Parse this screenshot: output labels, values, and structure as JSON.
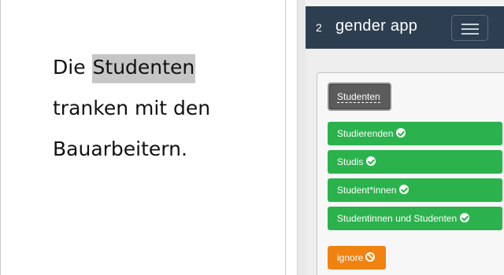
{
  "document": {
    "text_before": "Die ",
    "highlighted_word": "Studenten",
    "text_after_line1": "",
    "line2": "tranken mit den",
    "line3": "Bauarbeitern."
  },
  "navbar": {
    "version": "2",
    "brand": "gender app",
    "menu_icon": "hamburger-icon"
  },
  "panel": {
    "selected_word": "Studenten",
    "alternatives": [
      {
        "label": "Studierenden",
        "icon": "check-circle-icon"
      },
      {
        "label": "Studis",
        "icon": "check-circle-icon"
      },
      {
        "label": "Student*innen",
        "icon": "check-circle-icon"
      },
      {
        "label": "Studentinnen und Studenten",
        "icon": "check-circle-icon"
      }
    ],
    "ignore_label": "ignore",
    "ignore_icon": "ban-icon"
  },
  "colors": {
    "navbar": "#2d3e50",
    "alternative_button": "#2bb24c",
    "ignore_button": "#f0820f",
    "selected_word_button": "#5c5c5c",
    "highlight": "#c6c6c6"
  }
}
